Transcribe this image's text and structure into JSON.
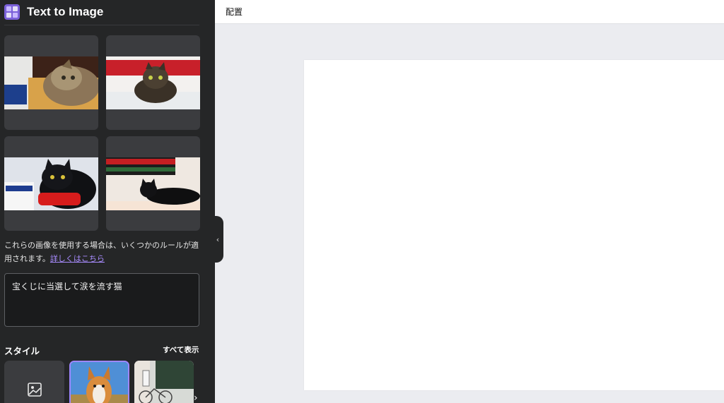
{
  "panel": {
    "title": "Text to Image",
    "notice_text": "これらの画像を使用する場合は、いくつかのルールが適用されます。",
    "notice_link": "詳しくはこちら",
    "prompt_value": "宝くじに当選して涙を流す猫",
    "styles_title": "スタイル",
    "show_all_label": "すべて表示"
  },
  "topbar": {
    "arrange_label": "配置"
  },
  "colors": {
    "panel_bg": "#252627",
    "card_bg": "#3b3c3f",
    "accent": "#7b61d9",
    "link": "#a98cff",
    "workspace_bg": "#ebecf0"
  },
  "icons": {
    "app": "text-to-image-app-icon",
    "collapse": "chevron-left-icon",
    "no_style": "image-icon",
    "next": "chevron-right-icon"
  }
}
